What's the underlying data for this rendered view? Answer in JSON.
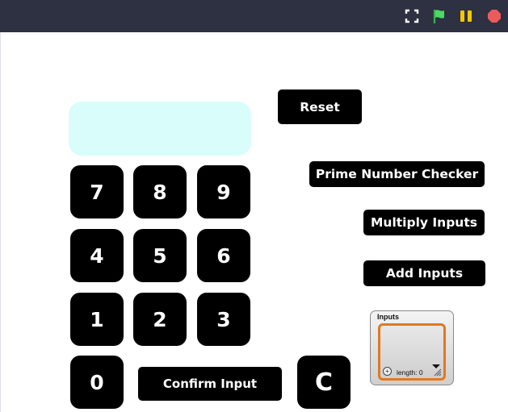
{
  "topbar": {
    "icons": [
      "fullscreen-icon",
      "green-flag-icon",
      "pause-icon",
      "stop-icon"
    ],
    "colors": {
      "background": "#2d3142",
      "flag": "#4cd964",
      "pause": "#f6c600",
      "stop": "#ec5b5b"
    }
  },
  "display": {
    "value": "",
    "color": "#d9fdfb"
  },
  "keypad": {
    "k7": "7",
    "k8": "8",
    "k9": "9",
    "k4": "4",
    "k5": "5",
    "k6": "6",
    "k1": "1",
    "k2": "2",
    "k3": "3",
    "k0": "0",
    "clear": "C"
  },
  "buttons": {
    "reset": "Reset",
    "prime_checker": "Prime Number Checker",
    "multiply": "Multiply Inputs",
    "add": "Add Inputs",
    "confirm": "Confirm Input"
  },
  "monitor": {
    "title": "Inputs",
    "add_symbol": "+",
    "length_label": "length: 0",
    "accent": "#e0791f"
  }
}
